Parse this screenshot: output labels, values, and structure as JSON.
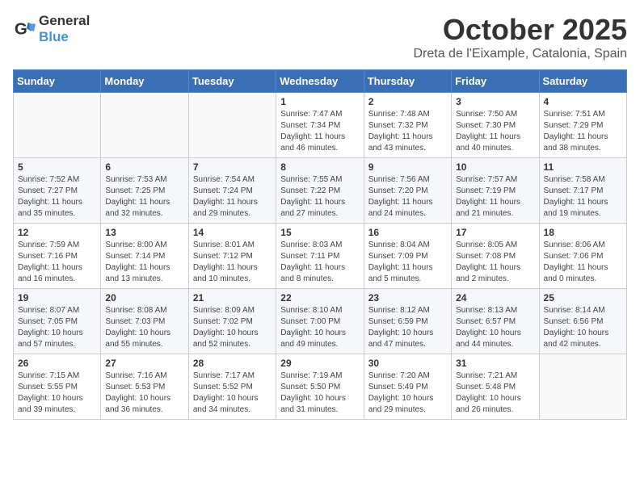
{
  "header": {
    "logo_general": "General",
    "logo_blue": "Blue",
    "month_title": "October 2025",
    "location": "Dreta de l'Eixample, Catalonia, Spain"
  },
  "weekdays": [
    "Sunday",
    "Monday",
    "Tuesday",
    "Wednesday",
    "Thursday",
    "Friday",
    "Saturday"
  ],
  "weeks": [
    [
      {
        "day": "",
        "info": ""
      },
      {
        "day": "",
        "info": ""
      },
      {
        "day": "",
        "info": ""
      },
      {
        "day": "1",
        "info": "Sunrise: 7:47 AM\nSunset: 7:34 PM\nDaylight: 11 hours and 46 minutes."
      },
      {
        "day": "2",
        "info": "Sunrise: 7:48 AM\nSunset: 7:32 PM\nDaylight: 11 hours and 43 minutes."
      },
      {
        "day": "3",
        "info": "Sunrise: 7:50 AM\nSunset: 7:30 PM\nDaylight: 11 hours and 40 minutes."
      },
      {
        "day": "4",
        "info": "Sunrise: 7:51 AM\nSunset: 7:29 PM\nDaylight: 11 hours and 38 minutes."
      }
    ],
    [
      {
        "day": "5",
        "info": "Sunrise: 7:52 AM\nSunset: 7:27 PM\nDaylight: 11 hours and 35 minutes."
      },
      {
        "day": "6",
        "info": "Sunrise: 7:53 AM\nSunset: 7:25 PM\nDaylight: 11 hours and 32 minutes."
      },
      {
        "day": "7",
        "info": "Sunrise: 7:54 AM\nSunset: 7:24 PM\nDaylight: 11 hours and 29 minutes."
      },
      {
        "day": "8",
        "info": "Sunrise: 7:55 AM\nSunset: 7:22 PM\nDaylight: 11 hours and 27 minutes."
      },
      {
        "day": "9",
        "info": "Sunrise: 7:56 AM\nSunset: 7:20 PM\nDaylight: 11 hours and 24 minutes."
      },
      {
        "day": "10",
        "info": "Sunrise: 7:57 AM\nSunset: 7:19 PM\nDaylight: 11 hours and 21 minutes."
      },
      {
        "day": "11",
        "info": "Sunrise: 7:58 AM\nSunset: 7:17 PM\nDaylight: 11 hours and 19 minutes."
      }
    ],
    [
      {
        "day": "12",
        "info": "Sunrise: 7:59 AM\nSunset: 7:16 PM\nDaylight: 11 hours and 16 minutes."
      },
      {
        "day": "13",
        "info": "Sunrise: 8:00 AM\nSunset: 7:14 PM\nDaylight: 11 hours and 13 minutes."
      },
      {
        "day": "14",
        "info": "Sunrise: 8:01 AM\nSunset: 7:12 PM\nDaylight: 11 hours and 10 minutes."
      },
      {
        "day": "15",
        "info": "Sunrise: 8:03 AM\nSunset: 7:11 PM\nDaylight: 11 hours and 8 minutes."
      },
      {
        "day": "16",
        "info": "Sunrise: 8:04 AM\nSunset: 7:09 PM\nDaylight: 11 hours and 5 minutes."
      },
      {
        "day": "17",
        "info": "Sunrise: 8:05 AM\nSunset: 7:08 PM\nDaylight: 11 hours and 2 minutes."
      },
      {
        "day": "18",
        "info": "Sunrise: 8:06 AM\nSunset: 7:06 PM\nDaylight: 11 hours and 0 minutes."
      }
    ],
    [
      {
        "day": "19",
        "info": "Sunrise: 8:07 AM\nSunset: 7:05 PM\nDaylight: 10 hours and 57 minutes."
      },
      {
        "day": "20",
        "info": "Sunrise: 8:08 AM\nSunset: 7:03 PM\nDaylight: 10 hours and 55 minutes."
      },
      {
        "day": "21",
        "info": "Sunrise: 8:09 AM\nSunset: 7:02 PM\nDaylight: 10 hours and 52 minutes."
      },
      {
        "day": "22",
        "info": "Sunrise: 8:10 AM\nSunset: 7:00 PM\nDaylight: 10 hours and 49 minutes."
      },
      {
        "day": "23",
        "info": "Sunrise: 8:12 AM\nSunset: 6:59 PM\nDaylight: 10 hours and 47 minutes."
      },
      {
        "day": "24",
        "info": "Sunrise: 8:13 AM\nSunset: 6:57 PM\nDaylight: 10 hours and 44 minutes."
      },
      {
        "day": "25",
        "info": "Sunrise: 8:14 AM\nSunset: 6:56 PM\nDaylight: 10 hours and 42 minutes."
      }
    ],
    [
      {
        "day": "26",
        "info": "Sunrise: 7:15 AM\nSunset: 5:55 PM\nDaylight: 10 hours and 39 minutes."
      },
      {
        "day": "27",
        "info": "Sunrise: 7:16 AM\nSunset: 5:53 PM\nDaylight: 10 hours and 36 minutes."
      },
      {
        "day": "28",
        "info": "Sunrise: 7:17 AM\nSunset: 5:52 PM\nDaylight: 10 hours and 34 minutes."
      },
      {
        "day": "29",
        "info": "Sunrise: 7:19 AM\nSunset: 5:50 PM\nDaylight: 10 hours and 31 minutes."
      },
      {
        "day": "30",
        "info": "Sunrise: 7:20 AM\nSunset: 5:49 PM\nDaylight: 10 hours and 29 minutes."
      },
      {
        "day": "31",
        "info": "Sunrise: 7:21 AM\nSunset: 5:48 PM\nDaylight: 10 hours and 26 minutes."
      },
      {
        "day": "",
        "info": ""
      }
    ]
  ]
}
